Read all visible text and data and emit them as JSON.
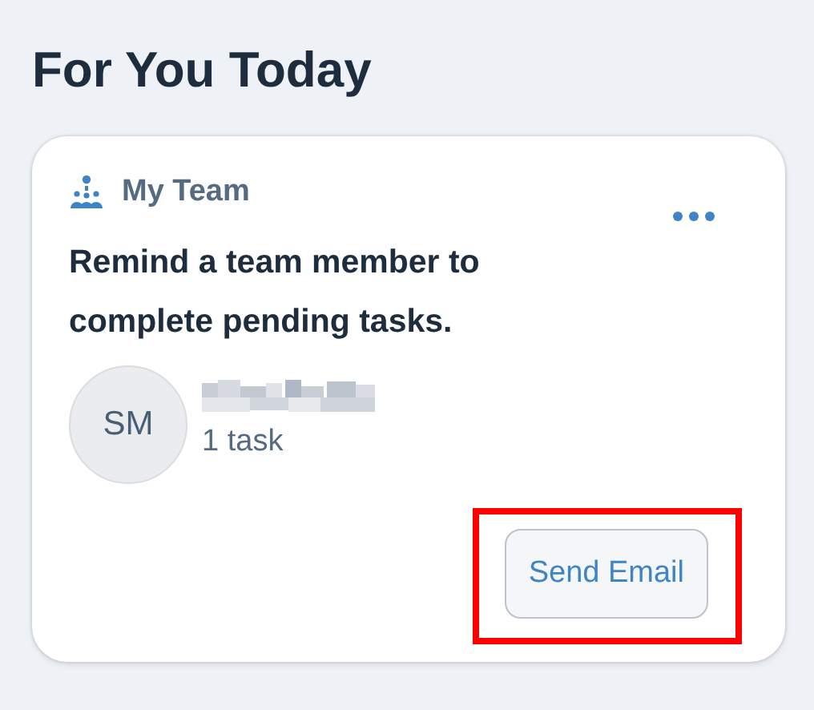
{
  "heading": "For You Today",
  "card": {
    "category": "My Team",
    "headline": "Remind a team member to complete pending tasks.",
    "person": {
      "initials": "SM",
      "detail": "1 task"
    },
    "action": {
      "label": "Send Email",
      "highlighted": true
    }
  }
}
